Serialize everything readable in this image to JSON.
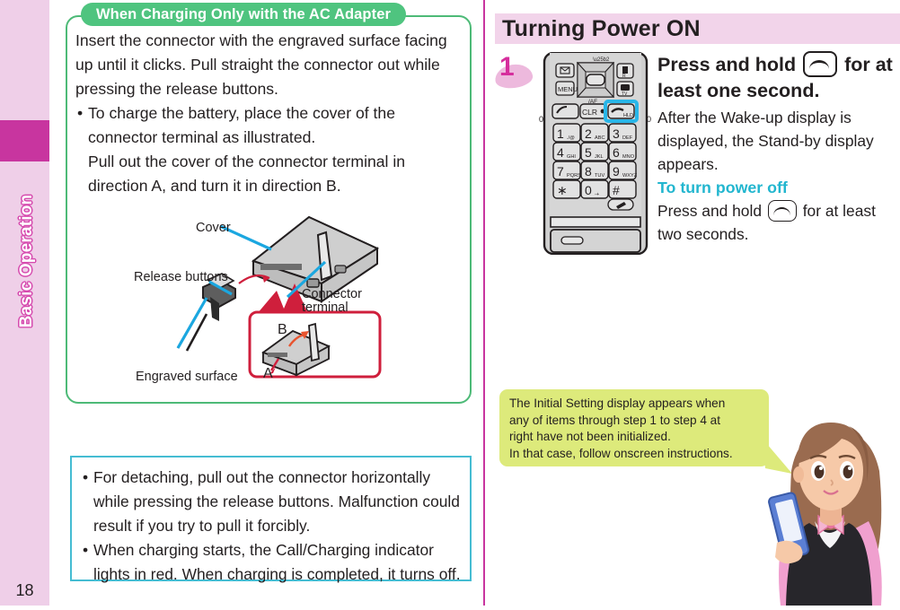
{
  "sidebar": {
    "section_label": "Basic Operation",
    "page_number": "18",
    "bg_color": "#efcfe8",
    "block_color": "#c8359f"
  },
  "left_panel": {
    "tab_label": "When Charging Only with the AC Adapter",
    "tab_color": "#4fc47f",
    "paragraph": "Insert the connector with the engraved surface facing up until it clicks. Pull straight the connector out while pressing the release buttons.",
    "bullets": [
      {
        "dot": "•",
        "line1": "To charge the battery, place the cover of the connector terminal as illustrated.",
        "line2": "Pull out the cover of the connector terminal in direction A, and turn it in direction B."
      }
    ],
    "illustration": {
      "labels": {
        "cover": "Cover",
        "release_buttons": "Release buttons",
        "connector_terminal_line1": "Connector",
        "connector_terminal_line2": "terminal",
        "engraved_surface": "Engraved surface",
        "direction_a": "A",
        "direction_b": "B"
      },
      "callout_border_color": "#cf1f3c",
      "leader_line_color": "#1ba7e0"
    }
  },
  "left_note_box": {
    "border_color": "#45bcd2",
    "bullets": [
      {
        "dot": "•",
        "text": "For detaching, pull out the connector horizontally while pressing the release buttons. Malfunction could result if you try to pull it forcibly."
      },
      {
        "dot": "•",
        "text": "When charging starts, the Call/Charging indicator lights in red. When charging is completed, it turns off."
      }
    ]
  },
  "right_panel": {
    "title": "Turning Power ON",
    "title_bg_color": "#f2d4ea",
    "step_number": "1",
    "step_accent_color": "#d62e9d",
    "heading_before_key": "Press and hold",
    "heading_after_key": "for at least one second.",
    "body_text": "After the Wake-up display is displayed, the Stand-by display appears.",
    "subheading": "To turn power off",
    "subheading_color": "#22b6cf",
    "subbody_before_key": "Press and hold",
    "subbody_after_key": "for at least two seconds.",
    "key_icon_name": "end-call-key"
  },
  "phone_illustration": {
    "highlight_color": "#29b6e8",
    "highlighted_key": "end-call-power-key",
    "top_keys": [
      {
        "label": "mail-icon",
        "glyph": "✉"
      },
      {
        "label": "menu-key",
        "glyph": "MENU"
      },
      {
        "label": "memo-icon",
        "glyph": "▤"
      },
      {
        "label": "camera-tv-key",
        "glyph": "TV"
      }
    ],
    "nav_labels": {
      "up": "⬆",
      "center": "",
      "bottom": "□/AF"
    },
    "function_row": [
      {
        "label": "call-key",
        "glyph": ""
      },
      {
        "label": "clear-key",
        "glyph": "CLR"
      },
      {
        "label": "power-end-key",
        "glyph": "HLD"
      }
    ],
    "keypad": [
      [
        {
          "num": "1",
          "sub": "./@"
        },
        {
          "num": "2",
          "sub": "ABC"
        },
        {
          "num": "3",
          "sub": "DEF"
        }
      ],
      [
        {
          "num": "4",
          "sub": "GHI"
        },
        {
          "num": "5",
          "sub": "JKL"
        },
        {
          "num": "6",
          "sub": "MNO"
        }
      ],
      [
        {
          "num": "7",
          "sub": "PQRS"
        },
        {
          "num": "8",
          "sub": "TUV"
        },
        {
          "num": "9",
          "sub": "WXYZ"
        }
      ],
      [
        {
          "num": "∗",
          "sub": ""
        },
        {
          "num": "0",
          "sub": "-+"
        },
        {
          "num": "#",
          "sub": ""
        }
      ]
    ]
  },
  "balloon": {
    "bg_color": "#ddea7b",
    "line1": "The Initial Setting display appears when",
    "line2": "any of items through step 1 to step 4 at",
    "line3": "right have not been initialized.",
    "line4": "In that case, follow onscreen instructions."
  },
  "girl_illustration": {
    "name": "woman-holding-phone",
    "hair_color": "#9a6b4f",
    "skin_color": "#f6c9a8",
    "sleeve_color": "#f0a0cf",
    "vest_color": "#27262b",
    "phone_color": "#5b7fd4"
  }
}
